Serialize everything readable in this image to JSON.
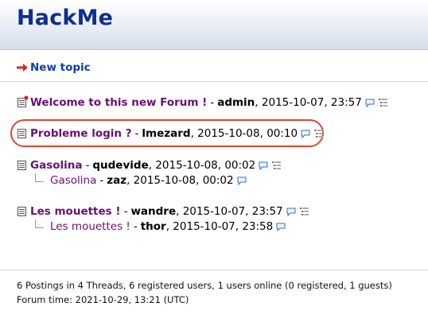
{
  "site": {
    "title": "HackMe"
  },
  "nav": {
    "new_topic_label": "New topic"
  },
  "threads": [
    {
      "title": "Welcome to this new Forum !",
      "author": "admin",
      "date": "2015-10-07, 23:57",
      "replies": []
    },
    {
      "title": "Probleme login ?",
      "author": "lmezard",
      "date": "2015-10-08, 00:10",
      "replies": []
    },
    {
      "title": "Gasolina",
      "author": "qudevide",
      "date": "2015-10-08, 00:02",
      "replies": [
        {
          "title": "Gasolina",
          "author": "zaz",
          "date": "2015-10-08, 00:02"
        }
      ]
    },
    {
      "title": "Les mouettes !",
      "author": "wandre",
      "date": "2015-10-07, 23:57",
      "replies": [
        {
          "title": "Les mouettes !",
          "author": "thor",
          "date": "2015-10-07, 23:58"
        }
      ]
    }
  ],
  "footer": {
    "stats": "6 Postings in 4 Threads, 6 registered users, 1 users online (0 registered, 1 guests)",
    "forum_time": "Forum time: 2021-10-29, 13:21 (UTC)"
  },
  "colors": {
    "accent": "#0e2f8e",
    "link_visited": "#6b0f73",
    "highlight": "#e1452e"
  },
  "icons": [
    "arrow-right-icon",
    "topic-icon",
    "new-post-icon",
    "speech-bubble-icon",
    "thread-view-icon"
  ]
}
